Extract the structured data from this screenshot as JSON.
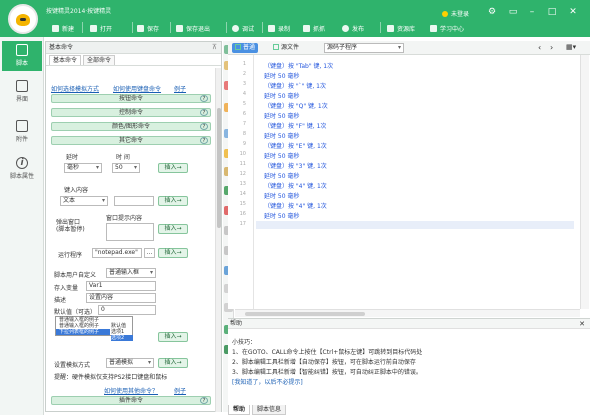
{
  "window": {
    "title": "按键精灵2014·按键精灵",
    "user_label": "未登录",
    "controls": [
      "gear-icon",
      "skin-icon",
      "minimize-icon",
      "maximize-icon",
      "close-icon"
    ]
  },
  "toolbar": {
    "items": [
      {
        "label": "新建",
        "icon": "plus-icon"
      },
      {
        "label": "打开",
        "icon": "folder-icon"
      },
      {
        "label": "保存",
        "icon": "save-icon"
      },
      {
        "label": "保存退出",
        "icon": "save-exit-icon"
      },
      {
        "label": "调试",
        "icon": "debug-icon"
      },
      {
        "label": "录制",
        "icon": "record-icon"
      },
      {
        "label": "抓抓",
        "icon": "grab-icon"
      },
      {
        "label": "发布",
        "icon": "publish-icon"
      },
      {
        "label": "资源库",
        "icon": "library-icon"
      },
      {
        "label": "学习中心",
        "icon": "learn-icon"
      }
    ]
  },
  "rail": [
    {
      "label": "脚本",
      "icon": "script-icon",
      "active": true
    },
    {
      "label": "界面",
      "icon": "ui-icon",
      "active": false
    },
    {
      "label": "附件",
      "icon": "attachment-icon",
      "active": false
    },
    {
      "label": "脚本属性",
      "icon": "info-icon",
      "active": false
    }
  ],
  "command_panel": {
    "header": "基本命令",
    "tabs": [
      "基本命令",
      "全部命令"
    ],
    "links_top": {
      "a": "如何选择模拟方式",
      "b": "如何使用键盘命令",
      "c": "例子"
    },
    "groups": [
      "按钮命令",
      "控制命令",
      "颜色/图形命令",
      "其它命令"
    ],
    "delay": {
      "label_delay": "延时",
      "label_time": "时 间",
      "unit": "毫秒",
      "value": "50"
    },
    "insert_label": "插入→",
    "input_content": {
      "label": "键入内容",
      "type": "文本"
    },
    "popup_window": {
      "label_left": "弹出窗口\n(脚本暂停)",
      "label_right": "窗口提示内容"
    },
    "run_program": {
      "label": "运行程序",
      "value": "\"notepad.exe\"",
      "browse": "..."
    },
    "user_custom": {
      "label": "脚本用户自定义",
      "type": "普通输入框"
    },
    "var_store": {
      "label": "存入变量",
      "value": "Var1"
    },
    "describe": {
      "label": "描述",
      "value": "设置内容"
    },
    "default": {
      "label": "默认值（可选）",
      "value": "0"
    },
    "dropdown": {
      "header": "普通输入框的例子",
      "items": [
        "普通输入框的例子",
        "下拉列表框的例子"
      ],
      "selected": 1,
      "side": [
        "默认值",
        "选项1",
        "选项2"
      ],
      "side_selected": 2
    },
    "sim_mode": {
      "label": "设置模拟方式",
      "value": "普通模拟"
    },
    "tip": "提醒：硬件模拟仅支持PS2接口键盘和鼠标",
    "link_bottom": {
      "a": "如何使用其他命令？",
      "b": "例子"
    },
    "bottom_group": "插件命令"
  },
  "editor": {
    "tabs": [
      {
        "label": "普通",
        "active": true
      },
      {
        "label": "源文件",
        "active": false
      }
    ],
    "mode_select": "源码子程序",
    "lines": [
      "（键盘）按 \"Tab\" 键, 1次",
      "延时 50 毫秒",
      "（键盘）按 \"`\" 键, 1次",
      "延时 50 毫秒",
      "（键盘）按 \"Q\" 键, 1次",
      "延时 50 毫秒",
      "（键盘）按 \"F\" 键, 1次",
      "延时 50 毫秒",
      "（键盘）按 \"E\" 键, 1次",
      "延时 50 毫秒",
      "（键盘）按 \"3\" 键, 1次",
      "延时 50 毫秒",
      "（键盘）按 \"4\" 键, 1次",
      "延时 50 毫秒",
      "（键盘）按 \"4\" 键, 1次",
      "延时 50 毫秒",
      ""
    ]
  },
  "help": {
    "title": "帮助",
    "lines": [
      "小技巧：",
      "1、在GOTO、CALL命令上按住【Ctrl+鼠标左键】可跳转到目标代码处",
      "2、脚本编辑工具栏新增【自动保存】按钮，可在脚本运行前自动保存",
      "3、脚本编辑工具栏新增【智能纠错】按钮，可自动纠正脚本中的错误。",
      "[我知道了，以后不必提示]"
    ],
    "tabs": [
      "帮助",
      "脚本信息"
    ]
  },
  "colors": {
    "titlebar": "#2fb36c",
    "code_text": "#2255dd",
    "accent_blue": "#4a90e2",
    "command_green": "#d8f0df"
  }
}
